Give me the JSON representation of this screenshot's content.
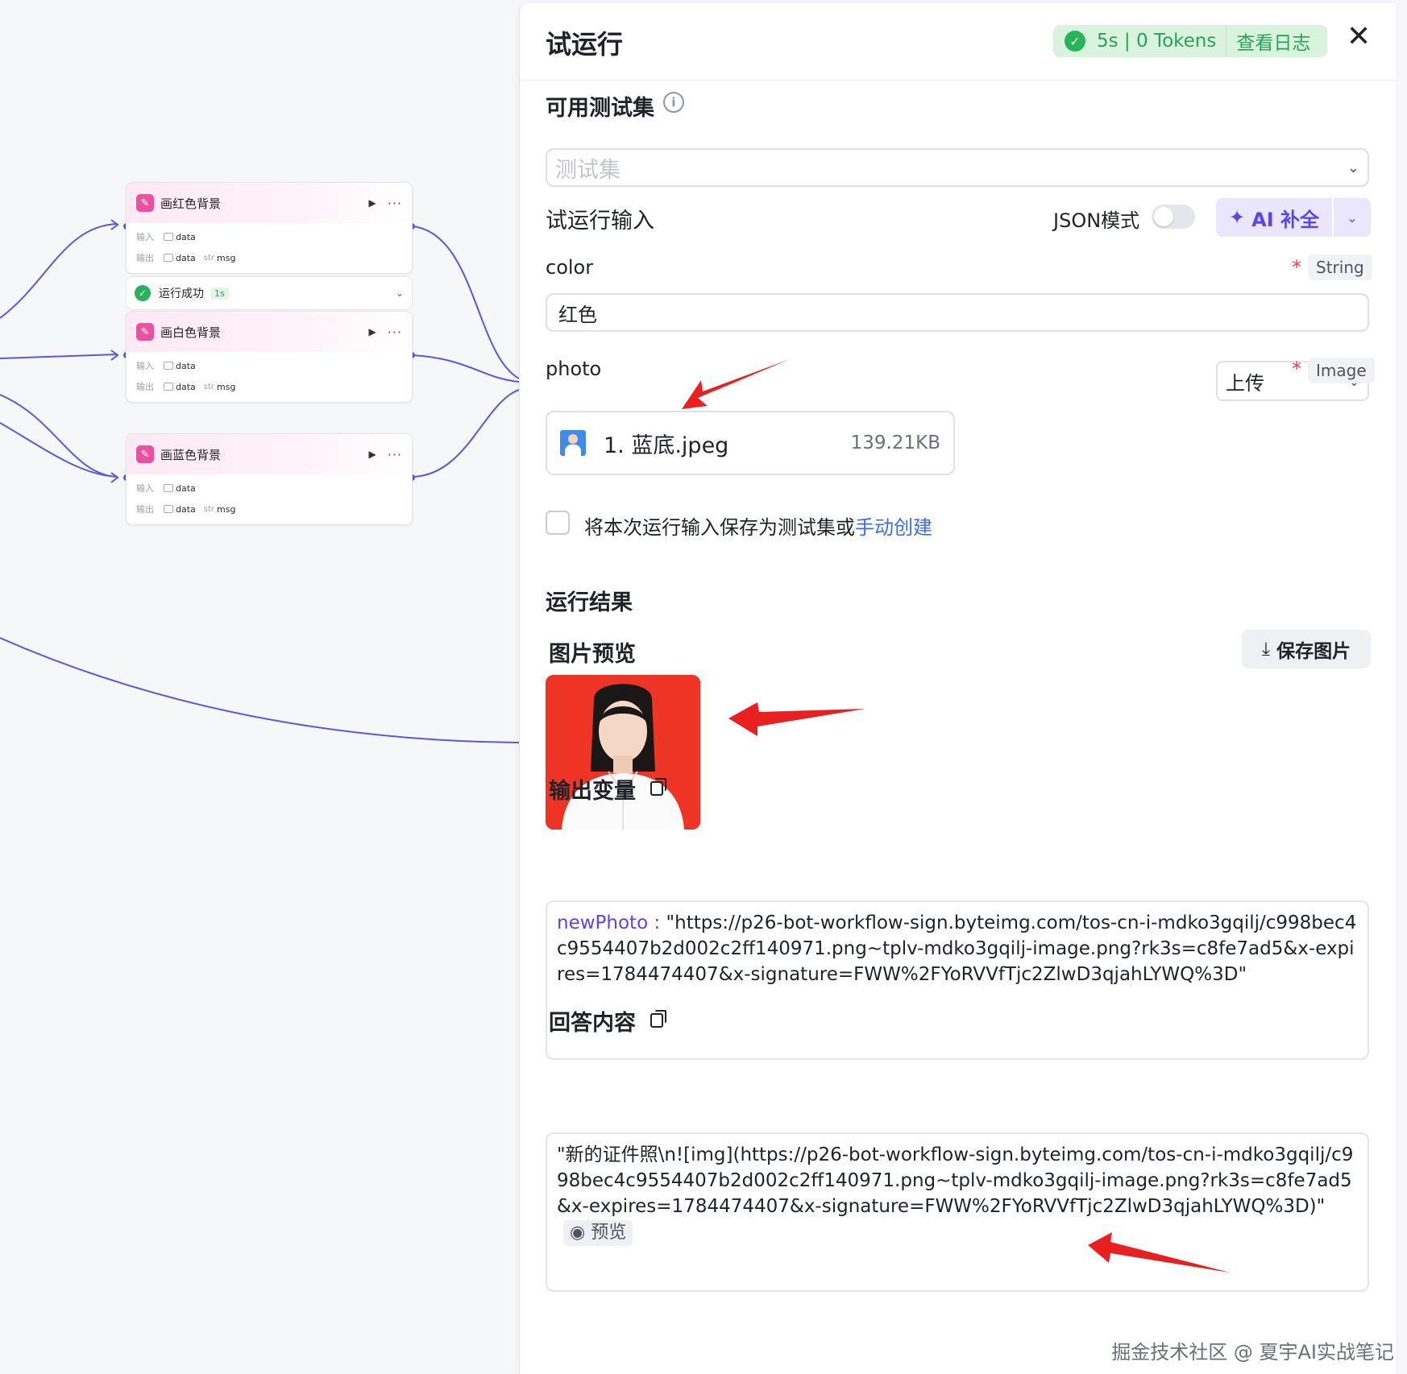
{
  "canvas": {
    "nodes": [
      {
        "title": "画红色背景",
        "input_label": "输入",
        "output_label": "输出",
        "in_var": "data",
        "out_var1": "data",
        "out_type2": "str",
        "out_var2": "msg"
      },
      {
        "title": "画白色背景",
        "input_label": "输入",
        "output_label": "输出",
        "in_var": "data",
        "out_var1": "data",
        "out_type2": "str",
        "out_var2": "msg"
      },
      {
        "title": "画蓝色背景",
        "input_label": "输入",
        "output_label": "输出",
        "in_var": "data",
        "out_var1": "data",
        "out_type2": "str",
        "out_var2": "msg"
      }
    ],
    "run_status": {
      "text": "运行成功",
      "duration": "1s"
    }
  },
  "panel": {
    "title": "试运行",
    "run_stats": "5s | 0 Tokens",
    "view_log": "查看日志",
    "testset_label": "可用测试集",
    "testset_placeholder": "测试集",
    "input_label": "试运行输入",
    "json_mode_label": "JSON模式",
    "json_mode_on": false,
    "ai_button": "AI 补全",
    "fields": {
      "color": {
        "name": "color",
        "type": "String",
        "value": "红色"
      },
      "photo": {
        "name": "photo",
        "type": "Image",
        "upload_label": "上传",
        "file_name": "1. 蓝底.jpeg",
        "file_size": "139.21KB"
      }
    },
    "save_checkbox_text": "将本次运行输入保存为测试集或",
    "save_link": "手动创建",
    "result_label": "运行结果",
    "preview_label": "图片预览",
    "save_image_button": "保存图片",
    "output_label": "输出变量",
    "output_key": "newPhoto",
    "output_sep": " : ",
    "output_value": "\"https://p26-bot-workflow-sign.byteimg.com/tos-cn-i-mdko3gqilj/c998bec4c9554407b2d002c2ff140971.png~tplv-mdko3gqilj-image.png?rk3s=c8fe7ad5&x-expires=1784474407&x-signature=FWW%2FYoRVVfTjc2ZlwD3qjahLYWQ%3D\"",
    "answer_label": "回答内容",
    "answer_value": "\"新的证件照\\n![img](https://p26-bot-workflow-sign.byteimg.com/tos-cn-i-mdko3gqilj/c998bec4c9554407b2d002c2ff140971.png~tplv-mdko3gqilj-image.png?rk3s=c8fe7ad5&x-expires=1784474407&x-signature=FWW%2FYoRVVfTjc2ZlwD3qjahLYWQ%3D)\"",
    "answer_preview": "预览"
  },
  "watermark": "掘金技术社区 @ 夏宇AI实战笔记",
  "colors": {
    "accent": "#5b45f0",
    "success": "#27b55a",
    "link": "#3b6cf0",
    "required": "#e8424d",
    "annotation_arrow": "#e8201f"
  },
  "icons": [
    "pencil-icon",
    "play-icon",
    "more-icon",
    "check-icon",
    "chevron-down-icon",
    "close-icon",
    "info-icon",
    "sparkle-icon",
    "download-icon",
    "copy-icon",
    "eye-icon"
  ]
}
